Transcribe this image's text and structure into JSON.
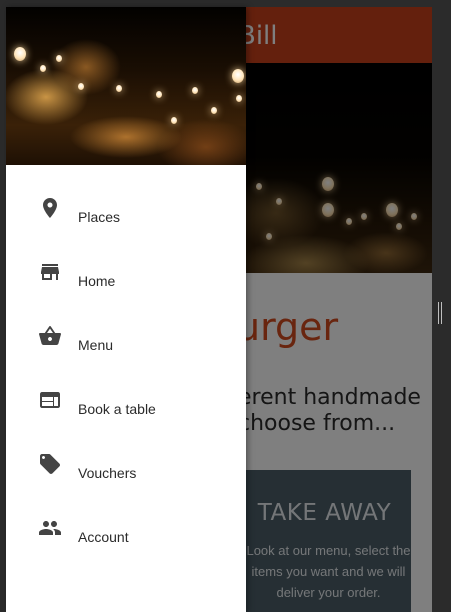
{
  "app": {
    "title": "Bill",
    "hero_image": "restaurant-night-lanterns",
    "content": {
      "title": "urger",
      "subtitle": "erent handmade choose from..."
    },
    "takeaway_card": {
      "title": "TAKE AWAY",
      "description": "Look at our menu, select the items you want and we will deliver your order."
    },
    "colors": {
      "accent": "#c8401b",
      "title_text": "#d24a1e",
      "card": "#4d5f68"
    }
  },
  "drawer": {
    "header_image": "restaurant-night-lanterns",
    "items": [
      {
        "label": "Places",
        "icon": "map-pin-icon"
      },
      {
        "label": "Home",
        "icon": "store-icon"
      },
      {
        "label": "Menu",
        "icon": "basket-icon"
      },
      {
        "label": "Book a table",
        "icon": "web-window-icon"
      },
      {
        "label": "Vouchers",
        "icon": "tag-icon"
      },
      {
        "label": "Account",
        "icon": "people-icon"
      }
    ]
  }
}
